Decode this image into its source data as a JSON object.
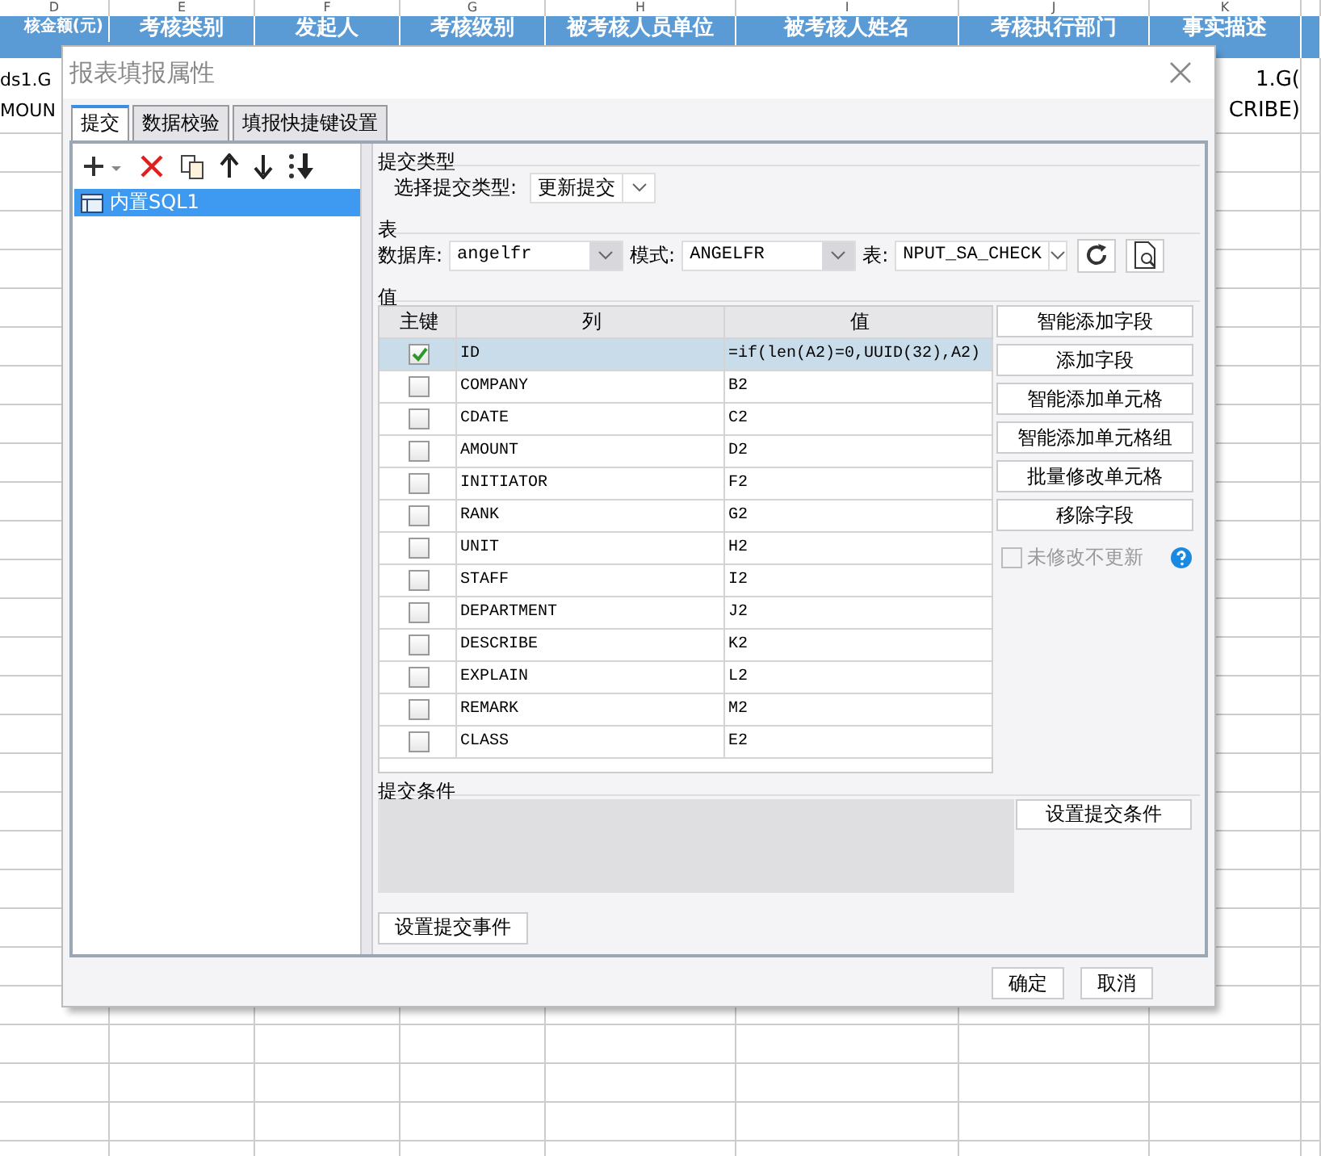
{
  "sheet": {
    "column_letters": [
      "D",
      "E",
      "F",
      "G",
      "H",
      "I",
      "J",
      "K"
    ],
    "header_cells": [
      "核金额(元)",
      "考核类别",
      "发起人",
      "考核级别",
      "被考核人员单位",
      "被考核人姓名",
      "考核执行部门",
      "事实描述"
    ],
    "left_cell": [
      "ds1.G",
      "MOUN"
    ],
    "right_cell": [
      "1.G(",
      "CRIBE)"
    ]
  },
  "dialog": {
    "title": "报表填报属性",
    "tabs": [
      {
        "label": "提交",
        "selected": true
      },
      {
        "label": "数据校验",
        "selected": false
      },
      {
        "label": "填报快捷键设置",
        "selected": false
      }
    ],
    "submit_list": [
      {
        "label": "内置SQL1",
        "selected": true
      }
    ],
    "submit_type": {
      "section": "提交类型",
      "label": "选择提交类型:",
      "value": "更新提交"
    },
    "table_section": {
      "section": "表",
      "db_label": "数据库:",
      "db_value": "angelfr",
      "schema_label": "模式:",
      "schema_value": "ANGELFR",
      "table_label": "表:",
      "table_value": "NPUT_SA_CHECK"
    },
    "values_section": {
      "section": "值",
      "columns": [
        "主键",
        "列",
        "值"
      ],
      "rows": [
        {
          "key": true,
          "selected": true,
          "column": "ID",
          "value": "=if(len(A2)=0,UUID(32),A2)"
        },
        {
          "key": false,
          "selected": false,
          "column": "COMPANY",
          "value": "B2"
        },
        {
          "key": false,
          "selected": false,
          "column": "CDATE",
          "value": "C2"
        },
        {
          "key": false,
          "selected": false,
          "column": "AMOUNT",
          "value": "D2"
        },
        {
          "key": false,
          "selected": false,
          "column": "INITIATOR",
          "value": "F2"
        },
        {
          "key": false,
          "selected": false,
          "column": "RANK",
          "value": "G2"
        },
        {
          "key": false,
          "selected": false,
          "column": "UNIT",
          "value": "H2"
        },
        {
          "key": false,
          "selected": false,
          "column": "STAFF",
          "value": "I2"
        },
        {
          "key": false,
          "selected": false,
          "column": "DEPARTMENT",
          "value": "J2"
        },
        {
          "key": false,
          "selected": false,
          "column": "DESCRIBE",
          "value": "K2"
        },
        {
          "key": false,
          "selected": false,
          "column": "EXPLAIN",
          "value": "L2"
        },
        {
          "key": false,
          "selected": false,
          "column": "REMARK",
          "value": "M2"
        },
        {
          "key": false,
          "selected": false,
          "column": "CLASS",
          "value": "E2"
        }
      ],
      "buttons": [
        "智能添加字段",
        "添加字段",
        "智能添加单元格",
        "智能添加单元格组",
        "批量修改单元格",
        "移除字段"
      ],
      "no_update_unchanged": {
        "label": "未修改不更新",
        "checked": false,
        "disabled": true
      }
    },
    "condition": {
      "section": "提交条件",
      "button": "设置提交条件"
    },
    "event_button": "设置提交事件",
    "footer_buttons": [
      "确定",
      "取消"
    ]
  }
}
